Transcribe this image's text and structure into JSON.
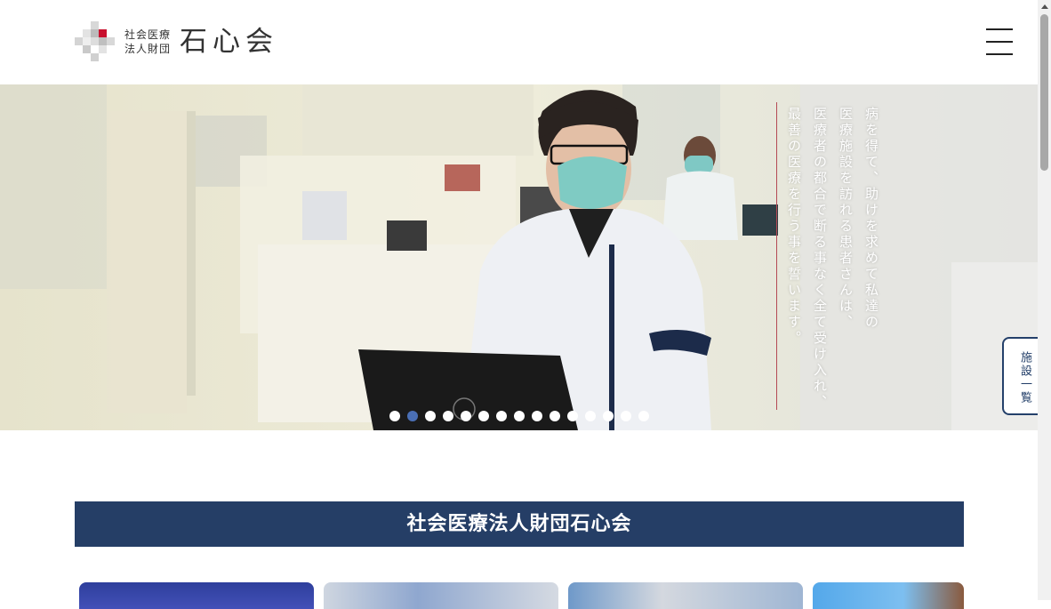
{
  "header": {
    "logo_sub_line1": "社会医療",
    "logo_sub_line2": "法人財団",
    "logo_main": "石心会",
    "menu_icon": "hamburger-menu-icon"
  },
  "hero": {
    "catch_lines": [
      "病を得て、助けを求めて私達の",
      "医療施設を訪れる患者さんは、",
      "医療者の都合で断る事なく全て受け入れ、",
      "最善の医療を行う事を誓います。"
    ],
    "slide_count": 15,
    "active_slide_index": 1,
    "accent_color": "#4a6fb5",
    "line_color": "#b54a55"
  },
  "side_tab": {
    "label": "施設一覧"
  },
  "section": {
    "title": "社会医療法人財団石心会",
    "bg_color": "#253e66"
  },
  "cards_count": 4
}
